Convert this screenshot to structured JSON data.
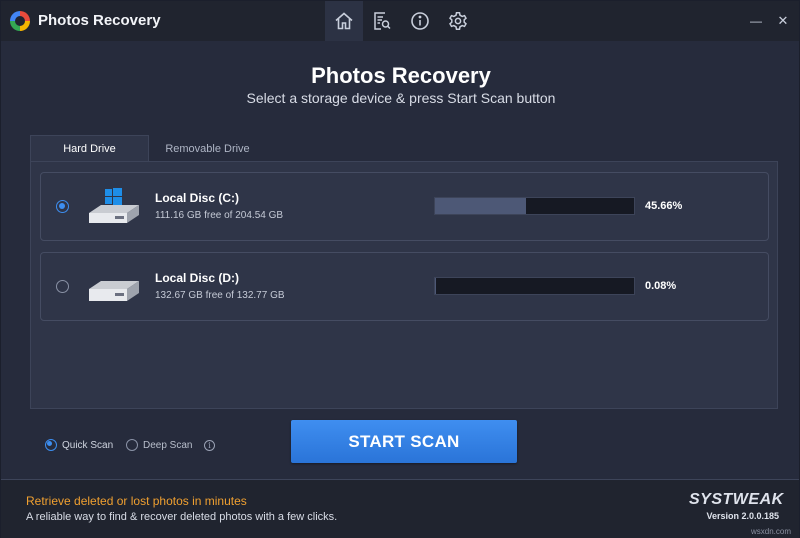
{
  "window": {
    "title": "Photos Recovery",
    "minimize_glyph": "—",
    "close_glyph": "✕"
  },
  "nav": [
    {
      "name": "home-icon",
      "active": true
    },
    {
      "name": "scan-log-icon",
      "active": false
    },
    {
      "name": "info-icon",
      "active": false
    },
    {
      "name": "settings-icon",
      "active": false
    }
  ],
  "header": {
    "title": "Photos Recovery",
    "subtitle": "Select a storage device & press Start Scan button"
  },
  "tabs": [
    {
      "label": "Hard Drive",
      "active": true
    },
    {
      "label": "Removable Drive",
      "active": false
    }
  ],
  "drives": [
    {
      "name": "Local Disc (C:)",
      "free": "111.16 GB free of 204.54 GB",
      "percent_label": "45.66%",
      "usage_fraction": 0.4566,
      "selected": true,
      "icon": "windows-drive-icon"
    },
    {
      "name": "Local Disc (D:)",
      "free": "132.67 GB free of 132.77 GB",
      "percent_label": "0.08%",
      "usage_fraction": 0.0008,
      "selected": false,
      "icon": "hard-drive-icon"
    }
  ],
  "scan": {
    "quick_label": "Quick Scan",
    "deep_label": "Deep Scan",
    "selected": "quick",
    "info_glyph": "i",
    "start_label": "START SCAN"
  },
  "footer": {
    "tagline": "Retrieve deleted or lost photos in minutes",
    "description": "A reliable way to find & recover deleted photos with a few clicks.",
    "brand": "SYSTWEAK",
    "version": "Version 2.0.0.185",
    "watermark": "wsxdn.com"
  },
  "colors": {
    "accent": "#3d8ef0",
    "tagline": "#f0a030",
    "background": "#262b3c"
  }
}
